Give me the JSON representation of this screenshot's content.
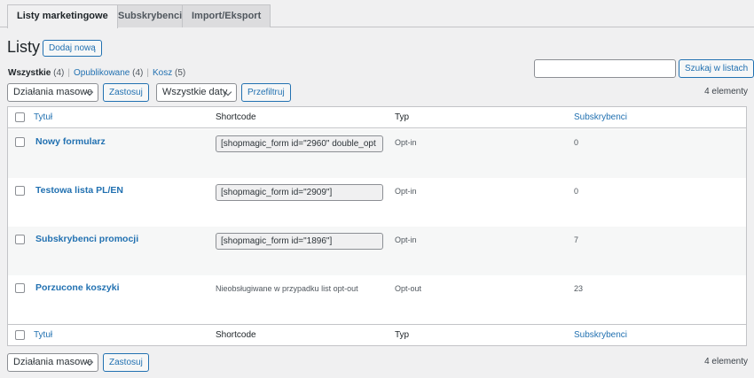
{
  "tabs": [
    {
      "label": "Listy marketingowe",
      "active": true
    },
    {
      "label": "Subskrybenci",
      "active": false
    },
    {
      "label": "Import/Eksport",
      "active": false
    }
  ],
  "page": {
    "title": "Listy",
    "add_new": "Dodaj nową"
  },
  "filters_views": {
    "all_label": "Wszystkie",
    "all_count": "(4)",
    "published_label": "Opublikowane",
    "published_count": "(4)",
    "trash_label": "Kosz",
    "trash_count": "(5)"
  },
  "search": {
    "button": "Szukaj w listach",
    "value": ""
  },
  "toolbar_top": {
    "bulk_select": "Działania masowe",
    "apply": "Zastosuj",
    "date_select": "Wszystkie daty",
    "filter": "Przefiltruj",
    "count": "4 elementy"
  },
  "toolbar_bottom": {
    "bulk_select": "Działania masowe",
    "apply": "Zastosuj",
    "count": "4 elementy"
  },
  "table": {
    "columns": {
      "title": "Tytuł",
      "shortcode": "Shortcode",
      "type": "Typ",
      "subscribers": "Subskrybenci"
    },
    "rows": [
      {
        "title": "Nowy formularz",
        "shortcode": "[shopmagic_form id=\"2960\" double_opt",
        "type": "Opt-in",
        "subscribers": "0"
      },
      {
        "title": "Testowa lista PL/EN",
        "shortcode": "[shopmagic_form id=\"2909\"]",
        "type": "Opt-in",
        "subscribers": "0"
      },
      {
        "title": "Subskrybenci promocji",
        "shortcode": "[shopmagic_form id=\"1896\"]",
        "type": "Opt-in",
        "subscribers": "7"
      },
      {
        "title": "Porzucone koszyki",
        "note": "Nieobsługiwane w przypadku list opt-out",
        "type": "Opt-out",
        "subscribers": "23"
      }
    ]
  },
  "colors": {
    "link": "#2271b1",
    "background": "#f0f0f1",
    "border": "#c3c4c7"
  }
}
